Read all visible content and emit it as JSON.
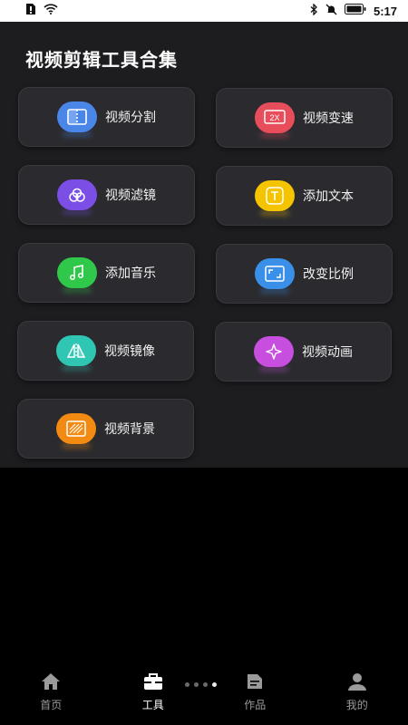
{
  "status": {
    "time": "5:17"
  },
  "title": "视频剪辑工具合集",
  "tools": [
    {
      "label": "视频分割",
      "icon": "split-icon",
      "color": "#4a86e8"
    },
    {
      "label": "视频变速",
      "icon": "speed-2x-icon",
      "color": "#e84d5b"
    },
    {
      "label": "视频滤镜",
      "icon": "filter-icon",
      "color": "#7b4ee6"
    },
    {
      "label": "添加文本",
      "icon": "text-icon",
      "color": "#f5c400"
    },
    {
      "label": "添加音乐",
      "icon": "music-note-icon",
      "color": "#2fc84a"
    },
    {
      "label": "改变比例",
      "icon": "aspect-ratio-icon",
      "color": "#3a8fe8"
    },
    {
      "label": "视频镜像",
      "icon": "mirror-icon",
      "color": "#2fc6b3"
    },
    {
      "label": "视频动画",
      "icon": "sparkle-icon",
      "color": "#c84ee0"
    },
    {
      "label": "视频背景",
      "icon": "background-icon",
      "color": "#f38a12"
    }
  ],
  "tabs": [
    {
      "label": "首页",
      "icon": "home-icon"
    },
    {
      "label": "工具",
      "icon": "toolbox-icon"
    },
    {
      "label": "作品",
      "icon": "document-icon"
    },
    {
      "label": "我的",
      "icon": "user-icon"
    }
  ]
}
